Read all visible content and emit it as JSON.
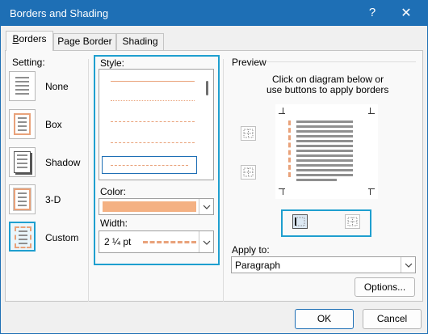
{
  "window": {
    "title": "Borders and Shading",
    "help": "?",
    "close": "✕"
  },
  "tabs": [
    {
      "label": "Borders",
      "key": "B"
    },
    {
      "label": "Page Border",
      "key": "P"
    },
    {
      "label": "Shading",
      "key": "S"
    }
  ],
  "setting": {
    "label": "Setting:",
    "items": [
      {
        "label": "None"
      },
      {
        "label": "Box"
      },
      {
        "label": "Shadow"
      },
      {
        "label": "3-D"
      },
      {
        "label": "Custom"
      }
    ],
    "selected": "Custom"
  },
  "style": {
    "label": "Style:",
    "options": [
      "solid",
      "dotted",
      "dashed-small",
      "dashed",
      "dash-dot"
    ],
    "selected": "dash-dot"
  },
  "color": {
    "label": "Color:",
    "value_color": "#f4b183"
  },
  "width": {
    "label": "Width:",
    "value": "2 ¼ pt"
  },
  "preview": {
    "label": "Preview",
    "instructions_line1": "Click on diagram below or",
    "instructions_line2": "use buttons to apply borders"
  },
  "apply_to": {
    "label": "Apply to:",
    "value": "Paragraph"
  },
  "buttons": {
    "options": "Options...",
    "ok": "OK",
    "cancel": "Cancel"
  },
  "colors": {
    "accent": "#1e6fb5",
    "highlight": "#1f9fcf",
    "border_color": "#f4b183"
  }
}
